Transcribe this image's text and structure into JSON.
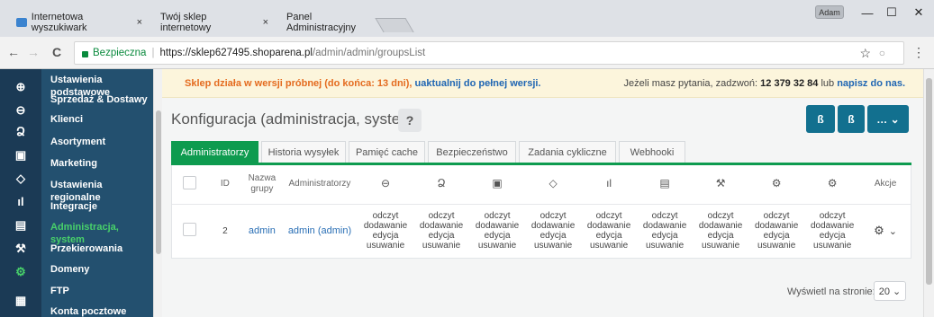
{
  "browser": {
    "tabs": [
      {
        "label": "Internetowa wyszukiwark",
        "close": "×"
      },
      {
        "label": "Twój sklep internetowy",
        "close": "×"
      },
      {
        "label": "Panel Administracyjny",
        "close": "×"
      }
    ],
    "window_user": "Adam",
    "win_buttons": {
      "minimize": "—",
      "maximize": "☐",
      "close": "✕"
    },
    "nav": {
      "back": "←",
      "forward": "→",
      "reload": "C"
    },
    "secure_label": "Bezpieczna",
    "url_base": "https://sklep627495.shoparena.pl",
    "url_path": "/admin/admin/groupsList",
    "star": "☆",
    "ext": "○",
    "menu": "⋮"
  },
  "rail_icons": [
    "⊕",
    "⊖",
    "Ձ",
    "▣",
    "◇",
    "ıl",
    "▤",
    "⚒",
    "⚙",
    "▦"
  ],
  "sidebar": {
    "items": [
      {
        "label": "Ustawienia podstawowe",
        "active": false
      },
      {
        "label": "Sprzedaż & Dostawy",
        "active": false
      },
      {
        "label": "Klienci",
        "active": false
      },
      {
        "label": "Asortyment",
        "active": false
      },
      {
        "label": "Marketing",
        "active": false
      },
      {
        "label": "Ustawienia regionalne",
        "active": false
      },
      {
        "label": "Integracje",
        "active": false
      },
      {
        "label": "Administracja, system",
        "active": true
      },
      {
        "label": "Przekierowania",
        "active": false
      },
      {
        "label": "Domeny",
        "active": false
      },
      {
        "label": "FTP",
        "active": false
      },
      {
        "label": "Konta pocztowe",
        "active": false
      }
    ]
  },
  "banner": {
    "warning": "Sklep działa w wersji próbnej (do końca: 13 dni),",
    "upgrade_link": "uaktualnij do pełnej wersji.",
    "question": "Jeżeli masz pytania, zadzwoń:",
    "phone": "12 379 32 84",
    "or": "lub",
    "write_link": "napisz do nas."
  },
  "page": {
    "title": "Konfiguracja (administracja, system)",
    "help": "?",
    "actions": {
      "btn1": "ß",
      "btn2": "ß",
      "more": "… ⌄"
    }
  },
  "tabs": [
    {
      "label": "Administratorzy",
      "active": true
    },
    {
      "label": "Historia wysyłek",
      "active": false
    },
    {
      "label": "Pamięć cache",
      "active": false
    },
    {
      "label": "Bezpieczeństwo",
      "active": false
    },
    {
      "label": "Zadania cykliczne",
      "active": false
    },
    {
      "label": "Webhooki",
      "active": false
    }
  ],
  "table": {
    "headers": {
      "id": "ID",
      "group_name": "Nazwa grupy",
      "admins": "Administratorzy",
      "actions": "Akcje"
    },
    "icon_columns": [
      "⊖",
      "Ձ",
      "▣",
      "◇",
      "ıl",
      "▤",
      "⚒",
      "⚙",
      "⚙"
    ],
    "rows": [
      {
        "id": "2",
        "group_name": "admin",
        "admins": "admin (admin)",
        "permissions": [
          "odczyt",
          "dodawanie",
          "edycja",
          "usuwanie"
        ],
        "gear": "⚙",
        "chevron": "⌄"
      }
    ]
  },
  "pager": {
    "label": "Wyświetl na stronie:",
    "value": "20 ⌄"
  }
}
